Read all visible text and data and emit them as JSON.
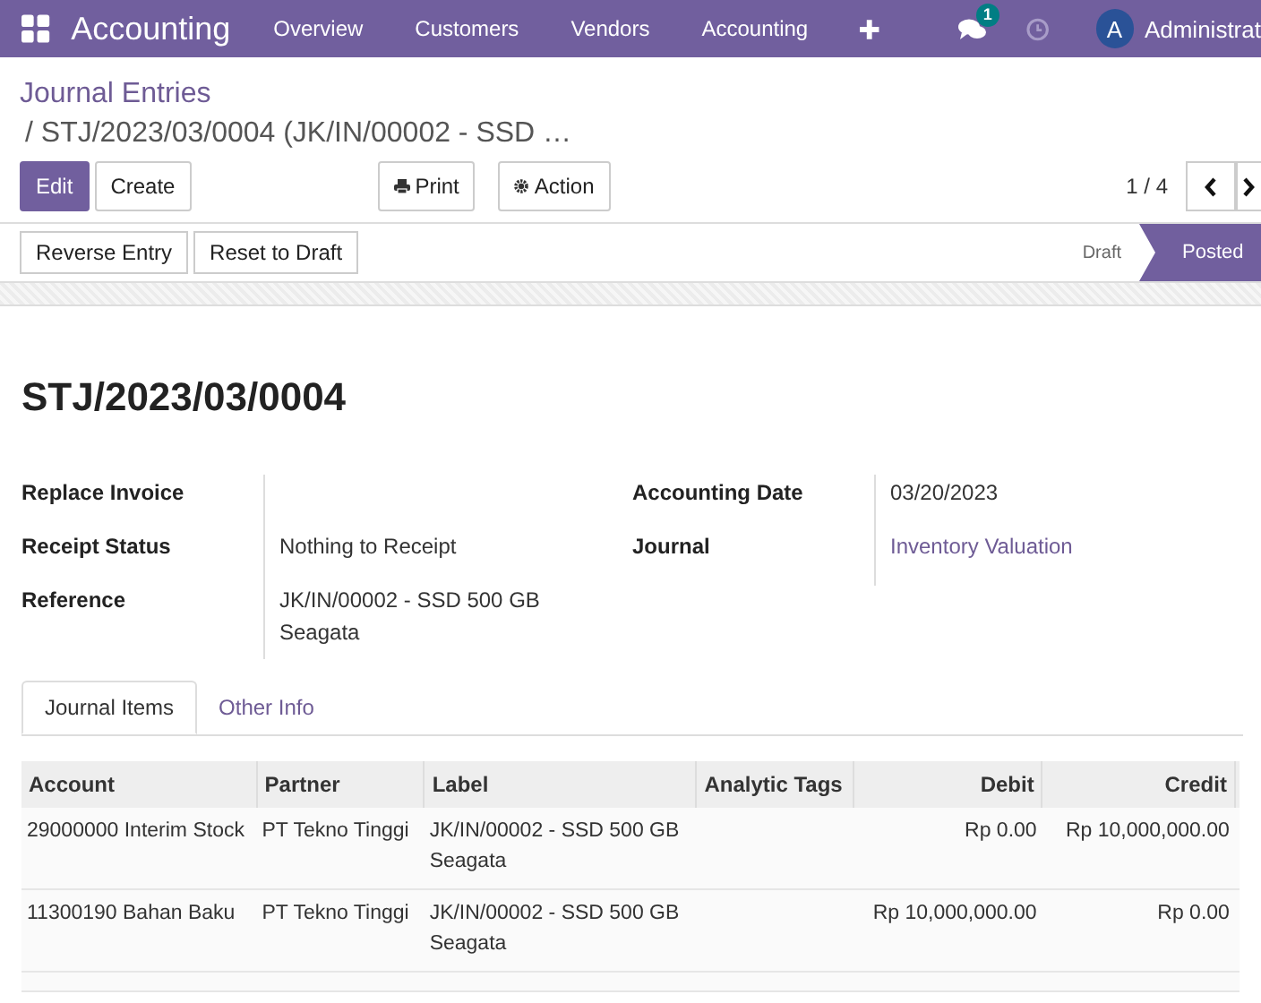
{
  "navbar": {
    "app_name": "Accounting",
    "menu": [
      {
        "label": "Overview"
      },
      {
        "label": "Customers"
      },
      {
        "label": "Vendors"
      },
      {
        "label": "Accounting"
      }
    ],
    "message_count": "1",
    "user": {
      "initial": "A",
      "name": "Administrat"
    }
  },
  "breadcrumb": {
    "parent": "Journal Entries",
    "current": "/ STJ/2023/03/0004 (JK/IN/00002 - SSD …"
  },
  "control_panel": {
    "primary": "Edit",
    "secondary": "Create",
    "print": "Print",
    "action": "Action",
    "pager": "1 / 4"
  },
  "status_bar": {
    "buttons": [
      "Reverse Entry",
      "Reset to Draft"
    ],
    "stages": [
      {
        "label": "Draft",
        "selected": false
      },
      {
        "label": "Posted",
        "selected": true
      }
    ]
  },
  "form": {
    "title": "STJ/2023/03/0004",
    "left_fields": [
      {
        "label": "Replace Invoice"
      },
      {
        "label": "Receipt Status",
        "value": "Nothing to Receipt"
      },
      {
        "label": "Reference",
        "value": "JK/IN/00002 - SSD 500 GB Seagata"
      }
    ],
    "right_fields": [
      {
        "label": "Accounting Date",
        "value": "03/20/2023",
        "kind": "text"
      },
      {
        "label": "Journal",
        "value": "Inventory Valuation",
        "kind": "link"
      }
    ],
    "tabs": [
      {
        "label": "Journal Items",
        "selected": true
      },
      {
        "label": "Other Info",
        "selected": false
      }
    ],
    "table": {
      "columns": [
        "Account",
        "Partner",
        "Label",
        "Analytic Tags",
        "Debit",
        "Credit"
      ],
      "rows": [
        [
          "29000000 Interim Stock",
          "PT Tekno Tinggi",
          "JK/IN/00002 - SSD 500 GB Seagata",
          "",
          "Rp 0.00",
          "Rp 10,000,000.00"
        ],
        [
          "11300190 Bahan Baku",
          "PT Tekno Tinggi",
          "JK/IN/00002 - SSD 500 GB Seagata",
          "",
          "Rp 10,000,000.00",
          "Rp 0.00"
        ]
      ]
    }
  }
}
